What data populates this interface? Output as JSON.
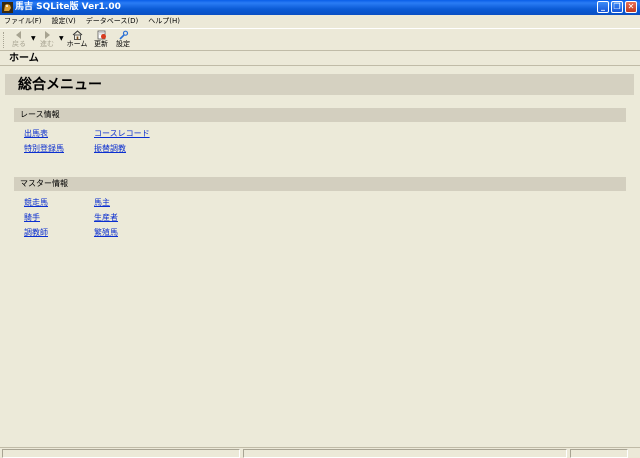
{
  "window": {
    "title": "馬吉 SQLite版  Ver1.00",
    "controls": {
      "minimize": "_",
      "restore": "❐",
      "close": "✕"
    }
  },
  "menubar": {
    "items": [
      {
        "label": "ファイル(F)"
      },
      {
        "label": "設定(V)"
      },
      {
        "label": "データベース(D)"
      },
      {
        "label": "ヘルプ(H)"
      }
    ]
  },
  "toolbar": {
    "back_label": "戻る",
    "forward_label": "進む",
    "home_label": "ホーム",
    "refresh_label": "更新",
    "settings_label": "設定"
  },
  "address": {
    "text": "ホーム"
  },
  "main": {
    "title": "総合メニュー",
    "sections": [
      {
        "title": "レース情報",
        "links": [
          "出馬表",
          "コースレコード",
          "特別登録馬",
          "振替調教"
        ]
      },
      {
        "title": "マスター情報",
        "links": [
          "競走馬",
          "馬主",
          "騎手",
          "生産者",
          "調教師",
          "繁殖馬"
        ]
      }
    ]
  },
  "colors": {
    "titlebar": "#0b5bd6",
    "background": "#ece9d8",
    "section_header": "#d3cfbf",
    "link": "#0b2fd0"
  },
  "icons": [
    "app-icon",
    "back-arrow-icon",
    "forward-arrow-icon",
    "home-icon",
    "refresh-icon",
    "settings-wrench-icon"
  ]
}
